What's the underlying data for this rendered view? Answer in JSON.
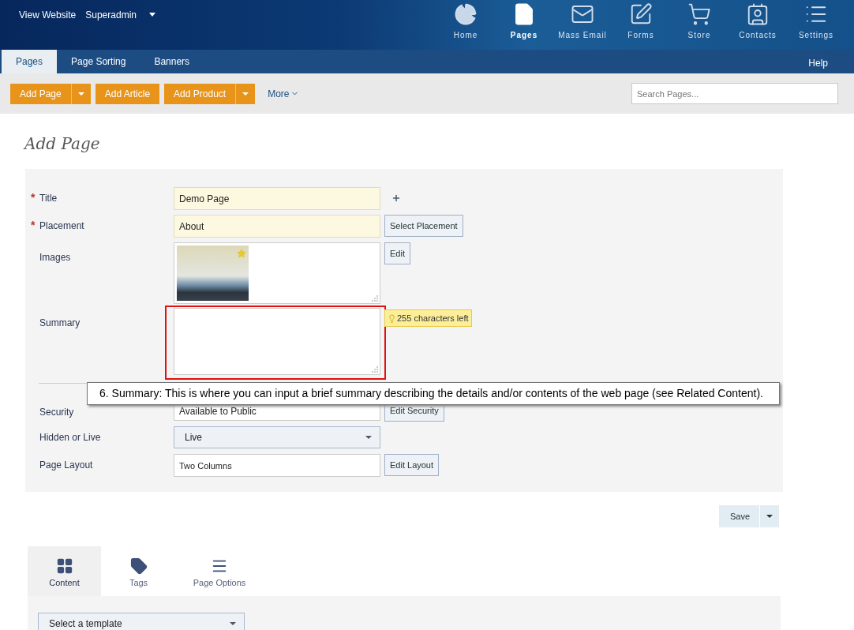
{
  "header": {
    "links": [
      "View Website",
      "Superadmin"
    ],
    "nav": [
      {
        "label": "Home",
        "selected": false
      },
      {
        "label": "Pages",
        "selected": true
      },
      {
        "label": "Mass Email",
        "selected": false
      },
      {
        "label": "Forms",
        "selected": false
      },
      {
        "label": "Store",
        "selected": false
      },
      {
        "label": "Contacts",
        "selected": false
      },
      {
        "label": "Settings",
        "selected": false
      }
    ]
  },
  "subnav": {
    "tabs": [
      {
        "label": "Pages",
        "selected": true
      },
      {
        "label": "Page Sorting",
        "selected": false
      },
      {
        "label": "Banners",
        "selected": false
      }
    ],
    "help": "Help"
  },
  "toolbar": {
    "buttons": [
      {
        "label": "Add Page",
        "dropdown": true
      },
      {
        "label": "Add Article",
        "dropdown": false
      },
      {
        "label": "Add Product",
        "dropdown": true
      }
    ],
    "more": "More",
    "search": {
      "placeholder": "Search Pages..."
    }
  },
  "heading": "Add Page",
  "form": {
    "fields": [
      {
        "kind": "text",
        "label": "Title",
        "required": true,
        "required_mark": "*",
        "value": "Demo Page",
        "add": true
      },
      {
        "kind": "text",
        "label": "Placement",
        "required": true,
        "required_mark": "*",
        "value": "About",
        "button": "Select Placement"
      },
      {
        "kind": "image",
        "label": "Images",
        "required": false,
        "button": "Edit",
        "starred": true
      },
      {
        "kind": "textarea",
        "label": "Summary",
        "required": false,
        "hint": "255 characters left",
        "highlighted": true
      },
      {
        "kind": "divider"
      },
      {
        "kind": "text",
        "label": "Security",
        "required": false,
        "value": "Available to Public",
        "button": "Edit Security"
      },
      {
        "kind": "select",
        "label": "Hidden or Live",
        "required": false,
        "value": "Live"
      },
      {
        "kind": "text",
        "label": "Page Layout",
        "required": false,
        "value": "Two Columns",
        "button": "Edit Layout",
        "small": true
      }
    ],
    "callout": "6. Summary: This is where you can input a brief summary describing the details and/or contents of the web page (see Related Content)."
  },
  "save": {
    "label": "Save"
  },
  "content_tabs": [
    {
      "label": "Content",
      "selected": true
    },
    {
      "label": "Tags",
      "selected": false
    },
    {
      "label": "Page Options",
      "selected": false
    }
  ],
  "template_select": {
    "placeholder": "Select a template"
  }
}
